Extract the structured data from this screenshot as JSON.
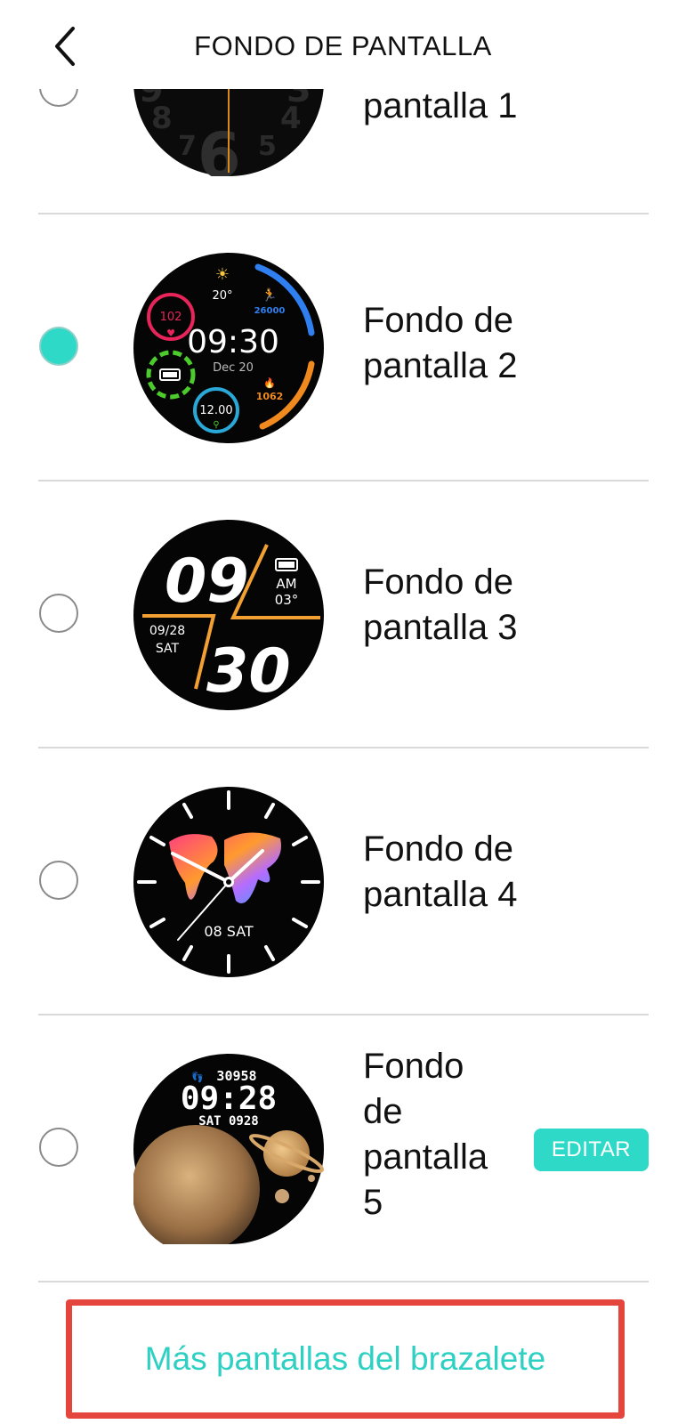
{
  "header": {
    "title": "FONDO DE PANTALLA",
    "back_icon": "chevron-left-icon"
  },
  "items": [
    {
      "label_lines": [
        "pantalla 1"
      ],
      "selected": false
    },
    {
      "label_lines": [
        "Fondo de",
        "pantalla 2"
      ],
      "selected": true,
      "face": {
        "weather": "20°",
        "heart": "102",
        "steps": "26000",
        "time": "09:30",
        "date": "Dec 20",
        "calories": "1062",
        "distance": "12.00"
      }
    },
    {
      "label_lines": [
        "Fondo de",
        "pantalla 3"
      ],
      "selected": false,
      "face": {
        "hour": "09",
        "minute": "30",
        "ampm": "AM",
        "sec": "03°",
        "date": "09/28",
        "day": "SAT"
      }
    },
    {
      "label_lines": [
        "Fondo de",
        "pantalla 4"
      ],
      "selected": false,
      "face": {
        "date": "08 SAT"
      }
    },
    {
      "label_lines": [
        "Fondo",
        "de",
        "pantalla",
        "5"
      ],
      "selected": false,
      "face": {
        "steps": "30958",
        "time": "09:28",
        "date": "SAT 0928"
      },
      "edit_label": "EDITAR"
    }
  ],
  "more_button": {
    "label": "Más pantallas del brazalete"
  },
  "colors": {
    "accent": "#2fd9c7",
    "highlight_border": "#e4463d",
    "divider": "#d9d9d9"
  }
}
